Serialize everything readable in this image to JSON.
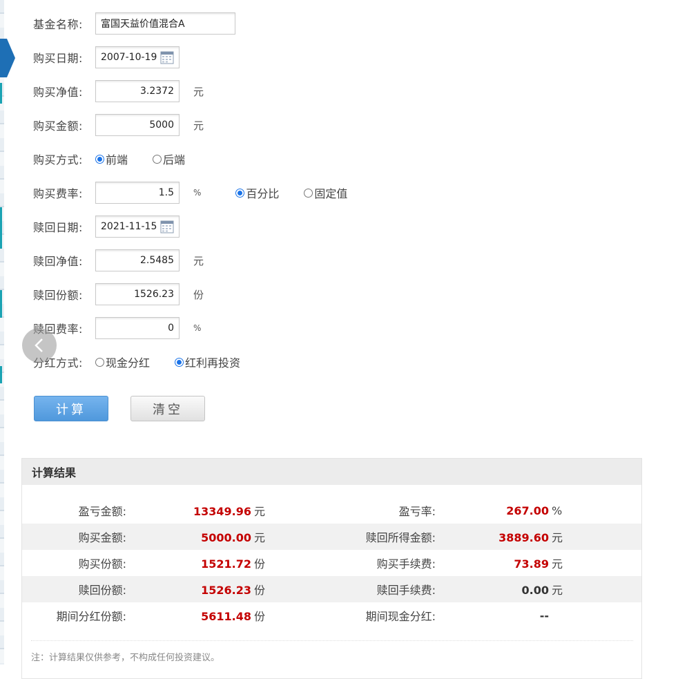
{
  "form": {
    "fund_name": {
      "label": "基金名称:",
      "value": "富国天益价值混合A"
    },
    "buy_date": {
      "label": "购买日期:",
      "value": "2007-10-19"
    },
    "buy_nav": {
      "label": "购买净值:",
      "value": "3.2372",
      "unit": "元"
    },
    "buy_amount": {
      "label": "购买金额:",
      "value": "5000",
      "unit": "元"
    },
    "buy_method": {
      "label": "购买方式:",
      "options": [
        "前端",
        "后端"
      ],
      "selected": "前端"
    },
    "buy_fee": {
      "label": "购买费率:",
      "value": "1.5",
      "unit": "%",
      "options": [
        "百分比",
        "固定值"
      ],
      "selected": "百分比"
    },
    "redeem_date": {
      "label": "赎回日期:",
      "value": "2021-11-15"
    },
    "redeem_nav": {
      "label": "赎回净值:",
      "value": "2.5485",
      "unit": "元"
    },
    "redeem_shares": {
      "label": "赎回份额:",
      "value": "1526.23",
      "unit": "份"
    },
    "redeem_fee": {
      "label": "赎回费率:",
      "value": "0",
      "unit": "%"
    },
    "dividend_method": {
      "label": "分红方式:",
      "options": [
        "现金分红",
        "红利再投资"
      ],
      "selected": "红利再投资"
    }
  },
  "buttons": {
    "calc": "计算",
    "clear": "清空"
  },
  "result": {
    "title": "计算结果",
    "rows": [
      {
        "l1": "盈亏金额:",
        "v1": "13349.96",
        "u1": "元",
        "l2": "盈亏率:",
        "v2": "267.00",
        "u2": "%"
      },
      {
        "l1": "购买金额:",
        "v1": "5000.00",
        "u1": "元",
        "l2": "赎回所得金额:",
        "v2": "3889.60",
        "u2": "元"
      },
      {
        "l1": "购买份额:",
        "v1": "1521.72",
        "u1": "份",
        "l2": "购买手续费:",
        "v2": "73.89",
        "u2": "元"
      },
      {
        "l1": "赎回份额:",
        "v1": "1526.23",
        "u1": "份",
        "l2": "赎回手续费:",
        "v2": "0.00",
        "u2": "元"
      },
      {
        "l1": "期间分红份额:",
        "v1": "5611.48",
        "u1": "份",
        "l2": "期间现金分红:",
        "v2": "--",
        "u2": ""
      }
    ],
    "note": "注：计算结果仅供参考，不构成任何投资建议。"
  },
  "colors": {
    "accent": "#4f98dc",
    "highlight": "#c40000",
    "radio": "#1a73e8"
  },
  "icons": {
    "calendar": "calendar-icon",
    "back": "chevron-left-icon",
    "side": "side-arrow-icon"
  }
}
